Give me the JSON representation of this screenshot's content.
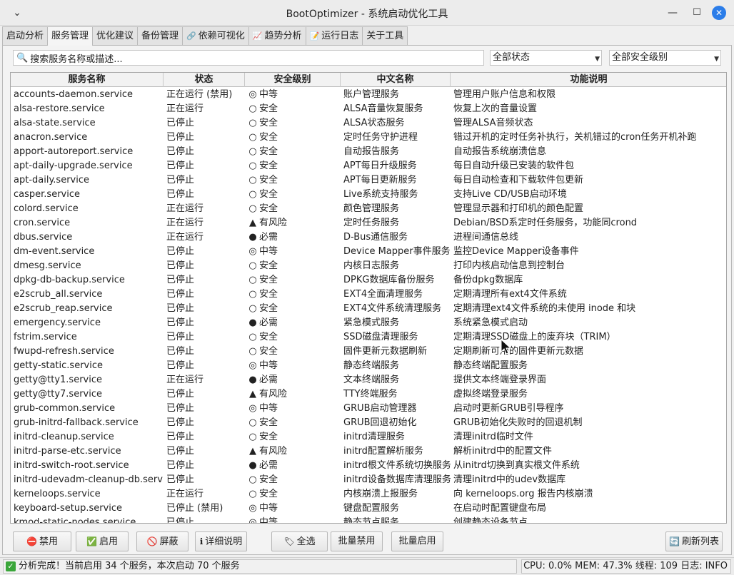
{
  "window": {
    "title": "BootOptimizer - 系统启动优化工具"
  },
  "tabs": [
    {
      "label": "启动分析",
      "icon": ""
    },
    {
      "label": "服务管理",
      "icon": ""
    },
    {
      "label": "优化建议",
      "icon": ""
    },
    {
      "label": "备份管理",
      "icon": ""
    },
    {
      "label": "依赖可视化",
      "icon": "link-icon"
    },
    {
      "label": "趋势分析",
      "icon": "chart-icon"
    },
    {
      "label": "运行日志",
      "icon": "log-icon"
    },
    {
      "label": "关于工具",
      "icon": ""
    }
  ],
  "active_tab": 1,
  "filters": {
    "search_placeholder": "搜索服务名称或描述...",
    "status_value": "全部状态",
    "security_value": "全部安全级别"
  },
  "table": {
    "headers": [
      "服务名称",
      "状态",
      "安全级别",
      "中文名称",
      "功能说明"
    ],
    "rows": [
      [
        "accounts-daemon.service",
        "正在运行 (禁用)",
        "◎",
        "中等",
        "账户管理服务",
        "管理用户账户信息和权限"
      ],
      [
        "alsa-restore.service",
        "正在运行",
        "○",
        "安全",
        "ALSA音量恢复服务",
        "恢复上次的音量设置"
      ],
      [
        "alsa-state.service",
        "已停止",
        "○",
        "安全",
        "ALSA状态服务",
        "管理ALSA音频状态"
      ],
      [
        "anacron.service",
        "已停止",
        "○",
        "安全",
        "定时任务守护进程",
        "错过开机的定时任务补执行，关机错过的cron任务开机补跑"
      ],
      [
        "apport-autoreport.service",
        "已停止",
        "○",
        "安全",
        "自动报告服务",
        "自动报告系统崩溃信息"
      ],
      [
        "apt-daily-upgrade.service",
        "已停止",
        "○",
        "安全",
        "APT每日升级服务",
        "每日自动升级已安装的软件包"
      ],
      [
        "apt-daily.service",
        "已停止",
        "○",
        "安全",
        "APT每日更新服务",
        "每日自动检查和下载软件包更新"
      ],
      [
        "casper.service",
        "已停止",
        "○",
        "安全",
        "Live系统支持服务",
        "支持Live CD/USB启动环境"
      ],
      [
        "colord.service",
        "正在运行",
        "○",
        "安全",
        "颜色管理服务",
        "管理显示器和打印机的颜色配置"
      ],
      [
        "cron.service",
        "正在运行",
        "▲",
        "有风险",
        "定时任务服务",
        "Debian/BSD系定时任务服务，功能同crond"
      ],
      [
        "dbus.service",
        "正在运行",
        "●",
        "必需",
        "D-Bus通信服务",
        "进程间通信总线"
      ],
      [
        "dm-event.service",
        "已停止",
        "◎",
        "中等",
        "Device Mapper事件服务",
        "监控Device Mapper设备事件"
      ],
      [
        "dmesg.service",
        "已停止",
        "○",
        "安全",
        "内核日志服务",
        "打印内核启动信息到控制台"
      ],
      [
        "dpkg-db-backup.service",
        "已停止",
        "○",
        "安全",
        "DPKG数据库备份服务",
        "备份dpkg数据库"
      ],
      [
        "e2scrub_all.service",
        "已停止",
        "○",
        "安全",
        "EXT4全面清理服务",
        "定期清理所有ext4文件系统"
      ],
      [
        "e2scrub_reap.service",
        "已停止",
        "○",
        "安全",
        "EXT4文件系统清理服务",
        "定期清理ext4文件系统的未使用 inode 和块"
      ],
      [
        "emergency.service",
        "已停止",
        "●",
        "必需",
        "紧急模式服务",
        "系统紧急模式启动"
      ],
      [
        "fstrim.service",
        "已停止",
        "○",
        "安全",
        "SSD磁盘清理服务",
        "定期清理SSD磁盘上的废弃块（TRIM）"
      ],
      [
        "fwupd-refresh.service",
        "已停止",
        "○",
        "安全",
        "固件更新元数据刷新",
        "定期刷新可用的固件更新元数据"
      ],
      [
        "getty-static.service",
        "已停止",
        "◎",
        "中等",
        "静态终端服务",
        "静态终端配置服务"
      ],
      [
        "getty@tty1.service",
        "正在运行",
        "●",
        "必需",
        "文本终端服务",
        "提供文本终端登录界面"
      ],
      [
        "getty@tty7.service",
        "已停止",
        "▲",
        "有风险",
        "TTY终端服务",
        "虚拟终端登录服务"
      ],
      [
        "grub-common.service",
        "已停止",
        "◎",
        "中等",
        "GRUB启动管理器",
        "启动时更新GRUB引导程序"
      ],
      [
        "grub-initrd-fallback.service",
        "已停止",
        "○",
        "安全",
        "GRUB回退初始化",
        "GRUB初始化失败时的回退机制"
      ],
      [
        "initrd-cleanup.service",
        "已停止",
        "○",
        "安全",
        "initrd清理服务",
        "清理initrd临时文件"
      ],
      [
        "initrd-parse-etc.service",
        "已停止",
        "▲",
        "有风险",
        "initrd配置解析服务",
        "解析initrd中的配置文件"
      ],
      [
        "initrd-switch-root.service",
        "已停止",
        "●",
        "必需",
        "initrd根文件系统切换服务",
        "从initrd切换到真实根文件系统"
      ],
      [
        "initrd-udevadm-cleanup-db.service",
        "已停止",
        "○",
        "安全",
        "initrd设备数据库清理服务",
        "清理initrd中的udev数据库"
      ],
      [
        "kerneloops.service",
        "正在运行",
        "○",
        "安全",
        "内核崩溃上报服务",
        "向 kerneloops.org 报告内核崩溃"
      ],
      [
        "keyboard-setup.service",
        "已停止 (禁用)",
        "◎",
        "中等",
        "键盘配置服务",
        "在启动时配置键盘布局"
      ],
      [
        "kmod-static-nodes.service",
        "已停止",
        "◎",
        "中等",
        "静态节点服务",
        "创建静态设备节点"
      ]
    ]
  },
  "buttons": {
    "disable": "禁用",
    "enable": "启用",
    "mask": "屏蔽",
    "details": "详细说明",
    "select_all": "全选",
    "batch_disable": "批量禁用",
    "batch_enable": "批量启用",
    "refresh": "刷新列表"
  },
  "status": {
    "message": "分析完成！当前启用 34 个服务，本次启动 70 个服务",
    "system": "CPU: 0.0%  MEM: 47.3%  线程: 109  日志: INFO"
  },
  "colors": {
    "accent": "#2b7de9",
    "success": "#3aa63a",
    "stop": "#d23b3b"
  }
}
